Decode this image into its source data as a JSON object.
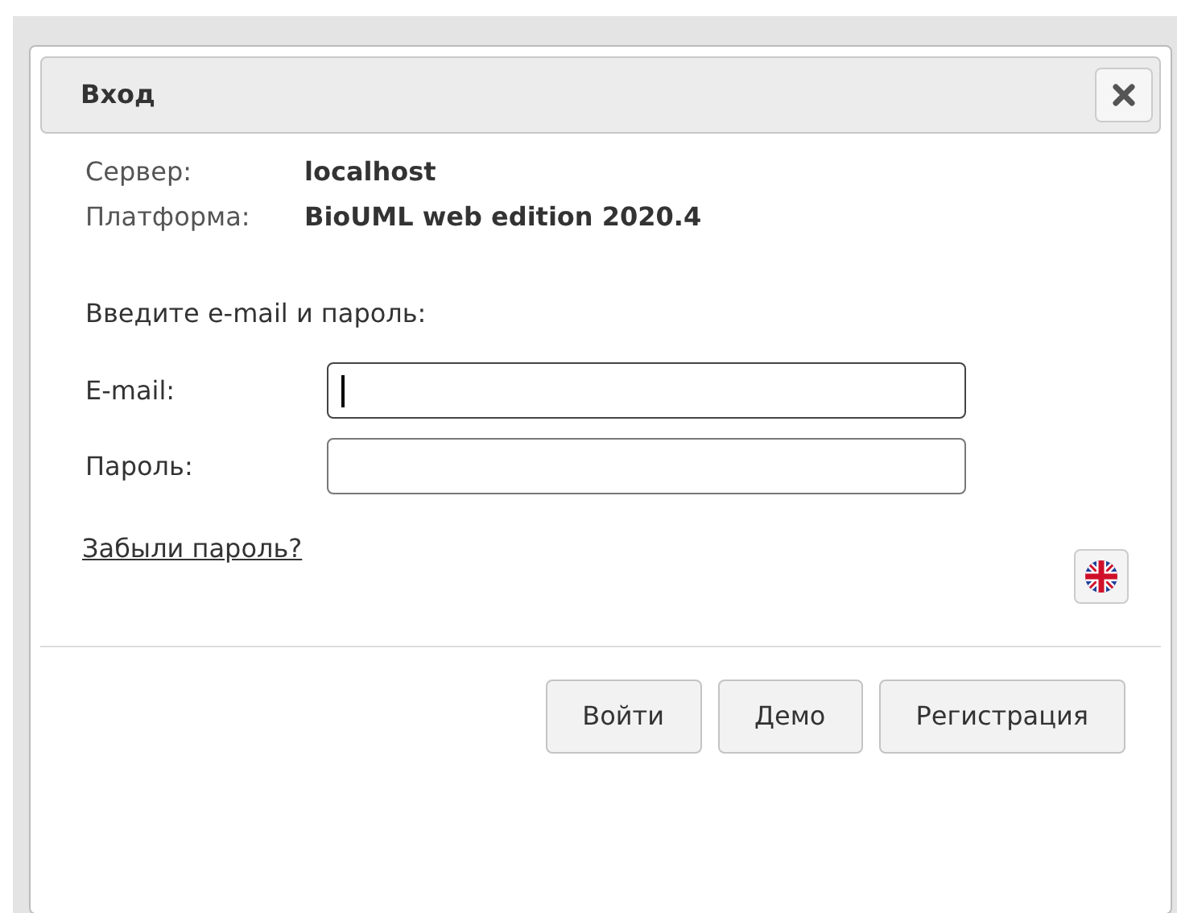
{
  "dialog": {
    "title": "Вход"
  },
  "info": [
    {
      "label": "Сервер:",
      "value": "localhost"
    },
    {
      "label": "Платформа:",
      "value": "BioUML web edition 2020.4"
    }
  ],
  "prompt": "Введите e-mail и пароль:",
  "fields": [
    {
      "label": "E-mail:",
      "focused": true
    },
    {
      "label": "Пароль:",
      "focused": false
    }
  ],
  "forgot_link": "Забыли пароль?",
  "buttons": [
    "Войти",
    "Демо",
    "Регистрация"
  ]
}
